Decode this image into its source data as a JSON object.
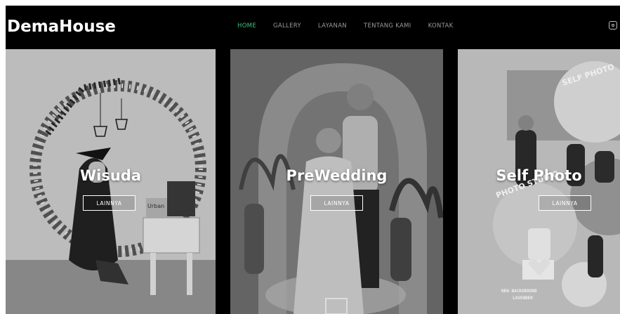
{
  "brand": {
    "name": "DemaHouse"
  },
  "nav": [
    {
      "label": "HOME"
    },
    {
      "label": "GALLERY"
    },
    {
      "label": "LAYANAN"
    },
    {
      "label": "TENTANG KAMI"
    },
    {
      "label": "KONTAK"
    }
  ],
  "header": {
    "social_icon": "instagram-icon"
  },
  "colors": {
    "nav_active": "#3fc37a",
    "header_bg": "#000000"
  },
  "panels": [
    {
      "title": "Wisuda",
      "button": "LAINNYA",
      "photo_text": [
        "Urban"
      ]
    },
    {
      "title": "PreWedding",
      "button": "LAINNYA"
    },
    {
      "title": "Self Photo",
      "button": "LAINNYA",
      "photo_text": [
        "SELF PHOTO",
        "PHOTO STUDIO",
        "NEW BACKGROUND",
        "LAVENDER"
      ]
    }
  ]
}
